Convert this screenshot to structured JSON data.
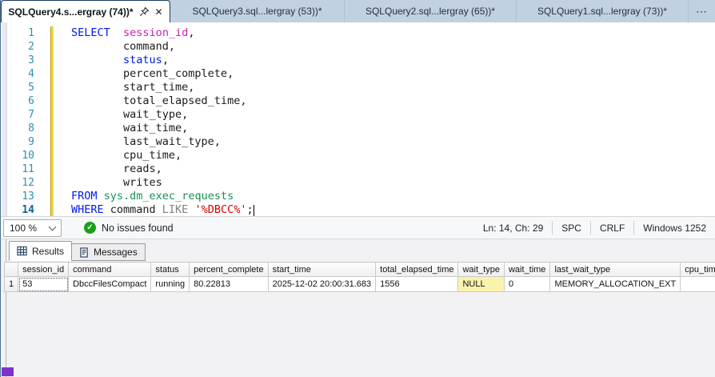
{
  "tabs": {
    "items": [
      {
        "label": "SQLQuery4.s...ergray (74))*",
        "active": true
      },
      {
        "label": "SQLQuery3.sql...lergray (53))*",
        "active": false
      },
      {
        "label": "SQLQuery2.sql...lergray (65))*",
        "active": false
      },
      {
        "label": "SQLQuery1.sql...lergray (73))*",
        "active": false
      }
    ],
    "overflow_label": "⋯"
  },
  "editor": {
    "line_numbers": [
      "1",
      "2",
      "3",
      "4",
      "5",
      "6",
      "7",
      "8",
      "9",
      "10",
      "11",
      "12",
      "13",
      "14"
    ],
    "code": {
      "l1": {
        "kw": "SELECT",
        "t1": "  ",
        "col": "session_id",
        "t2": ","
      },
      "l2": {
        "t": "        command,"
      },
      "l3": {
        "i": "        ",
        "kw": "status",
        "t": ","
      },
      "l4": {
        "t": "        percent_complete,"
      },
      "l5": {
        "t": "        start_time,"
      },
      "l6": {
        "t": "        total_elapsed_time,"
      },
      "l7": {
        "t": "        wait_type,"
      },
      "l8": {
        "t": "        wait_time,"
      },
      "l9": {
        "t": "        last_wait_type,"
      },
      "l10": {
        "t": "        cpu_time,"
      },
      "l11": {
        "t": "        reads,"
      },
      "l12": {
        "t": "        writes"
      },
      "l13": {
        "kw": "FROM",
        "t1": " ",
        "tbl": "sys.dm_exec_requests"
      },
      "l14": {
        "kw": "WHERE",
        "t1": " command ",
        "op": "LIKE",
        "t2": " ",
        "str": "'%DBCC%'",
        "t3": ";"
      }
    }
  },
  "statusbar": {
    "zoom_level": "100 %",
    "issues_message": "No issues found",
    "position": "Ln: 14, Ch: 29",
    "spc": "SPC",
    "line_ending": "CRLF",
    "encoding": "Windows 1252"
  },
  "results": {
    "tabs": [
      {
        "label": "Results",
        "active": true
      },
      {
        "label": "Messages",
        "active": false
      }
    ],
    "grid": {
      "columns": [
        "",
        "session_id",
        "command",
        "status",
        "percent_complete",
        "start_time",
        "total_elapsed_time",
        "wait_type",
        "wait_time",
        "last_wait_type",
        "cpu_time"
      ],
      "rows": [
        {
          "row_num": "1",
          "session_id": "53",
          "command": "DbccFilesCompact",
          "status": "running",
          "percent_complete": "80.22813",
          "start_time": "2025-12-02 20:00:31.683",
          "total_elapsed_time": "1556",
          "wait_type": "NULL",
          "wait_time": "0",
          "last_wait_type": "MEMORY_ALLOCATION_EXT",
          "cpu_time": ""
        }
      ]
    }
  },
  "colors": {
    "tabbar_bg": "#C2D1E1",
    "keyword_blue": "#0018E8",
    "column_magenta": "#C71FB4",
    "table_green": "#169154",
    "operator_gray": "#808080",
    "string_red": "#D40000",
    "line_number_teal": "#2B91AF",
    "null_cell_bg": "#FAF3AE",
    "success_green": "#18A018",
    "accent_chip_purple": "#7E30C8"
  }
}
